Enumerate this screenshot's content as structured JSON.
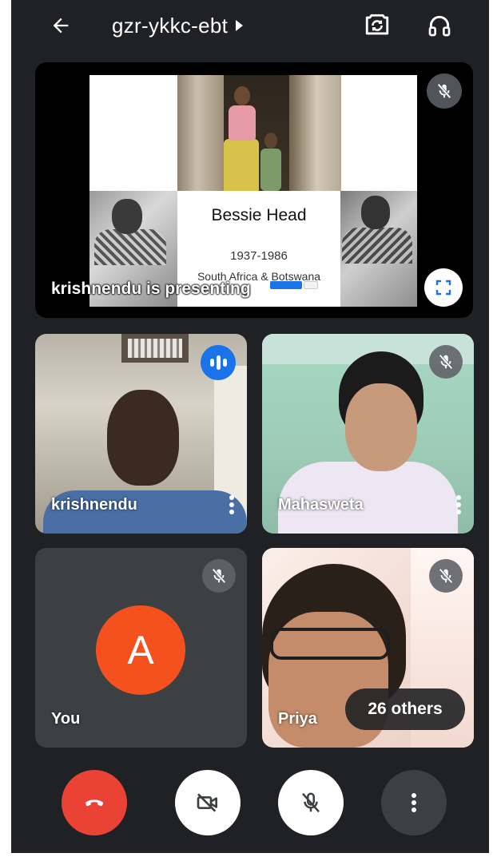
{
  "header": {
    "meeting_code": "gzr-ykkc-ebt",
    "back_icon": "arrow-left-icon",
    "switch_camera_icon": "camera-switch-icon",
    "audio_icon": "headphones-icon"
  },
  "presentation": {
    "label": "krishnendu is presenting",
    "slide": {
      "title": "Bessie Head",
      "years": "1937-1986",
      "place": "South Africa & Botswana"
    }
  },
  "participants": [
    {
      "name": "krishnendu",
      "status": "speaking"
    },
    {
      "name": "Mahasweta",
      "status": "muted"
    },
    {
      "name": "You",
      "avatar_letter": "A",
      "status": "muted"
    },
    {
      "name": "Priya",
      "status": "muted"
    }
  ],
  "others": {
    "label": "26 others"
  },
  "colors": {
    "background": "#202124",
    "hangup": "#ea4335",
    "avatar": "#f4511e",
    "speaking": "#1a73e8",
    "tile": "#3c4043"
  },
  "controls": {
    "hangup_icon": "phone-hangup-icon",
    "camera_icon": "camera-off-icon",
    "mic_icon": "mic-off-icon",
    "more_icon": "more-vertical-icon"
  }
}
